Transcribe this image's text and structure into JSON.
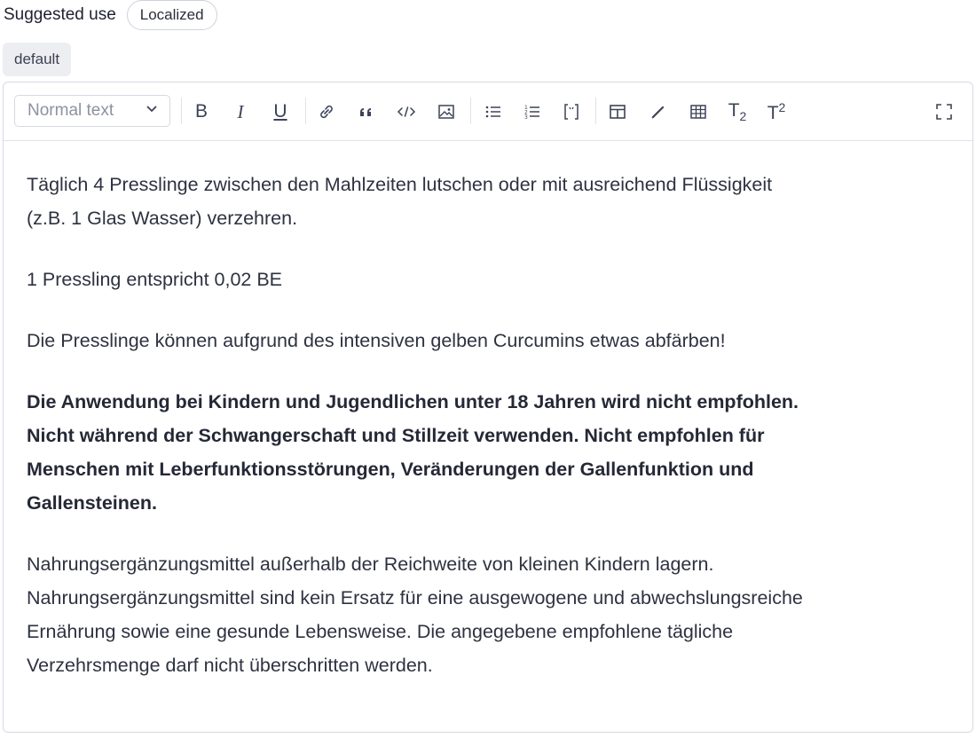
{
  "field": {
    "label": "Suggested use",
    "localized_badge": "Localized",
    "locale_tag": "default"
  },
  "toolbar": {
    "format_select": "Normal text",
    "buttons": [
      {
        "name": "bold",
        "label": "B"
      },
      {
        "name": "italic",
        "label": "I"
      },
      {
        "name": "underline",
        "label": "U"
      },
      {
        "name": "link"
      },
      {
        "name": "quote"
      },
      {
        "name": "code"
      },
      {
        "name": "image"
      },
      {
        "name": "bullet-list"
      },
      {
        "name": "numbered-list"
      },
      {
        "name": "embed"
      },
      {
        "name": "layout"
      },
      {
        "name": "highlight"
      },
      {
        "name": "table"
      },
      {
        "name": "subscript",
        "label": "T",
        "sub": "2"
      },
      {
        "name": "superscript",
        "label": "T",
        "sup": "2"
      },
      {
        "name": "fullscreen"
      }
    ]
  },
  "content": {
    "paragraphs": [
      {
        "lines": [
          "Täglich 4 Presslinge zwischen den Mahlzeiten lutschen oder mit ausreichend Flüssigkeit",
          "(z.B. 1 Glas Wasser) verzehren."
        ],
        "bold": false
      },
      {
        "lines": [
          "1 Pressling entspricht 0,02 BE"
        ],
        "bold": false
      },
      {
        "lines": [
          "Die Presslinge können aufgrund des intensiven gelben Curcumins etwas abfärben!"
        ],
        "bold": false
      },
      {
        "lines": [
          "Die Anwendung bei Kindern und Jugendlichen unter 18 Jahren wird nicht empfohlen.",
          "Nicht während der Schwangerschaft und Stillzeit verwenden. Nicht empfohlen für",
          "Menschen mit Leberfunktionsstörungen, Veränderungen der Gallenfunktion und",
          "Gallensteinen."
        ],
        "bold": true
      },
      {
        "lines": [
          "Nahrungsergänzungsmittel außerhalb der Reichweite von kleinen Kindern lagern.",
          "Nahrungsergänzungsmittel sind kein Ersatz für eine ausgewogene und abwechslungsreiche",
          "Ernährung sowie eine gesunde Lebensweise. Die angegebene empfohlene tägliche",
          "Verzehrsmenge darf nicht überschritten werden."
        ],
        "bold": false
      }
    ]
  }
}
